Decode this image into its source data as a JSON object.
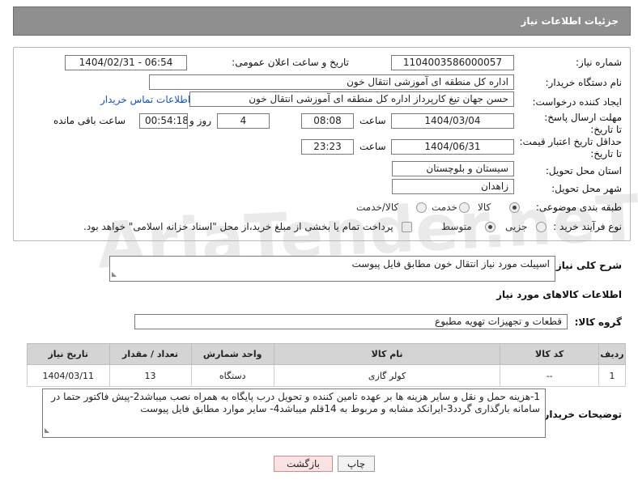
{
  "header": {
    "title": "جزئیات اطلاعات نیاز"
  },
  "form": {
    "need_number_label": "شماره نیاز:",
    "need_number": "1104003586000057",
    "announce_label": "تاریخ و ساعت اعلان عمومی:",
    "announce_value": "1404/02/31 - 06:54",
    "buyer_org_label": "نام دستگاه خریدار:",
    "buyer_org": "اداره کل منطقه ای آموزشی انتقال خون",
    "requester_label": "ایجاد کننده درخواست:",
    "requester": "حسن جهان تیغ کارپرداز اداره کل منطقه ای آموزشی انتقال خون",
    "contact_link": "اطلاعات تماس خریدار",
    "deadline_label": "مهلت ارسال پاسخ: تا تاریخ:",
    "deadline_date": "1404/03/04",
    "time_word": "ساعت",
    "deadline_time": "08:08",
    "days_value": "4",
    "days_word": "روز و",
    "remaining_time": "00:54:18",
    "remaining_word": "ساعت باقی مانده",
    "min_validity_label": "حداقل تاریخ اعتبار قیمت: تا تاریخ:",
    "validity_date": "1404/06/31",
    "validity_time": "23:23",
    "province_label": "استان محل تحویل:",
    "province": "سیستان و بلوچستان",
    "city_label": "شهر محل تحویل:",
    "city": "زاهدان",
    "category_label": "طبقه بندی موضوعی:",
    "category_options": [
      "کالا",
      "خدمت",
      "کالا/خدمت"
    ],
    "category_selected": "کالا",
    "process_label": "نوع فرآیند خرید :",
    "process_options": [
      "جزیی",
      "متوسط"
    ],
    "process_selected": "متوسط",
    "payment_note": "پرداخت تمام یا بخشی از مبلغ خرید،از محل \"اسناد خزانه اسلامی\" خواهد بود."
  },
  "description": {
    "label": "شرح کلی نیاز:",
    "text": "اسپیلت مورد نیاز انتقال خون مطابق فایل پیوست"
  },
  "goods": {
    "section_title": "اطلاعات کالاهای مورد نیاز",
    "group_label": "گروه کالا:",
    "group_value": "قطعات و تجهیزات تهویه مطبوع",
    "columns": [
      "ردیف",
      "کد کالا",
      "نام کالا",
      "واحد شمارش",
      "تعداد / مقدار",
      "تاریخ نیاز"
    ],
    "rows": [
      {
        "row": "1",
        "code": "--",
        "name": "کولر گازی",
        "unit": "دستگاه",
        "qty": "13",
        "date": "1404/03/11"
      }
    ]
  },
  "buyer_notes": {
    "label": "توضیحات خریدار:",
    "text": "1-هزینه حمل و نقل و سایر هزینه ها  بر عهده تامین کننده و تحویل درب پایگاه به همراه نصب میباشد2-پیش فاکتور حتما در سامانه بارگذاری گردد3-ایرانکد مشابه و مربوط به 14قلم میباشد4- سایر موارد مطابق فایل پیوست"
  },
  "buttons": {
    "print": "چاپ",
    "back": "بازگشت"
  },
  "watermark": {
    "text": "AriaTender.neT"
  }
}
